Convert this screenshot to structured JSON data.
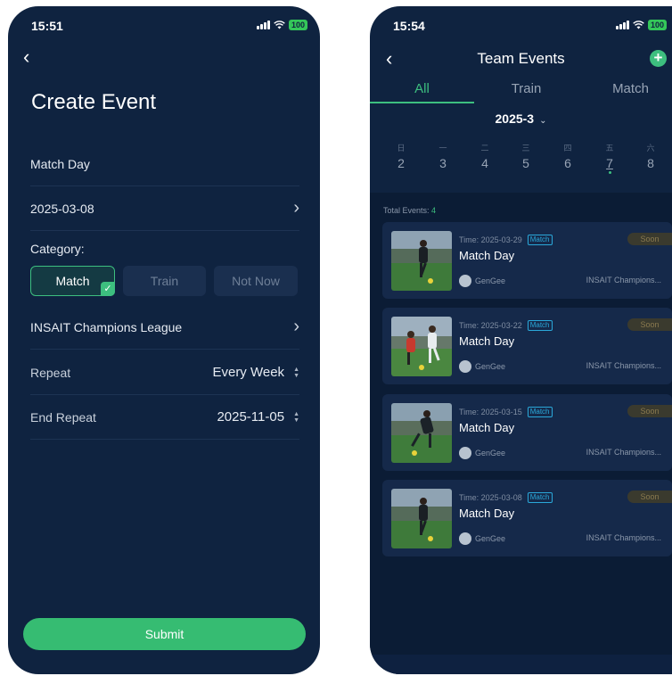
{
  "create_event": {
    "status_time": "15:51",
    "battery": "100",
    "title": "Create Event",
    "event_name": "Match Day",
    "date": "2025-03-08",
    "category_label": "Category:",
    "categories": [
      "Match",
      "Train",
      "Not Now"
    ],
    "selected_category": "Match",
    "league": "INSAIT Champions League",
    "repeat_label": "Repeat",
    "repeat_value": "Every Week",
    "end_repeat_label": "End Repeat",
    "end_repeat_value": "2025-11-05",
    "submit_label": "Submit"
  },
  "team_events": {
    "status_time": "15:54",
    "battery": "100",
    "title": "Team Events",
    "tabs": [
      "All",
      "Train",
      "Match"
    ],
    "active_tab": "All",
    "month": "2025-3",
    "weekdays": [
      "日",
      "一",
      "二",
      "三",
      "四",
      "五",
      "六"
    ],
    "dates": [
      "2",
      "3",
      "4",
      "5",
      "6",
      "7",
      "8"
    ],
    "today": "7",
    "total_label": "Total Events:",
    "total_count": "4",
    "events": [
      {
        "time": "Time: 2025-03-29",
        "tag": "Match",
        "status": "Soon",
        "name": "Match Day",
        "team": "GenGee",
        "league": "INSAIT Champions..."
      },
      {
        "time": "Time: 2025-03-22",
        "tag": "Match",
        "status": "Soon",
        "name": "Match Day",
        "team": "GenGee",
        "league": "INSAIT Champions..."
      },
      {
        "time": "Time: 2025-03-15",
        "tag": "Match",
        "status": "Soon",
        "name": "Match Day",
        "team": "GenGee",
        "league": "INSAIT Champions..."
      },
      {
        "time": "Time: 2025-03-08",
        "tag": "Match",
        "status": "Soon",
        "name": "Match Day",
        "team": "GenGee",
        "league": "INSAIT Champions..."
      }
    ]
  },
  "colors": {
    "background": "#0f2340",
    "accent": "#3dbf7f",
    "tag": "#2aa8d9"
  }
}
